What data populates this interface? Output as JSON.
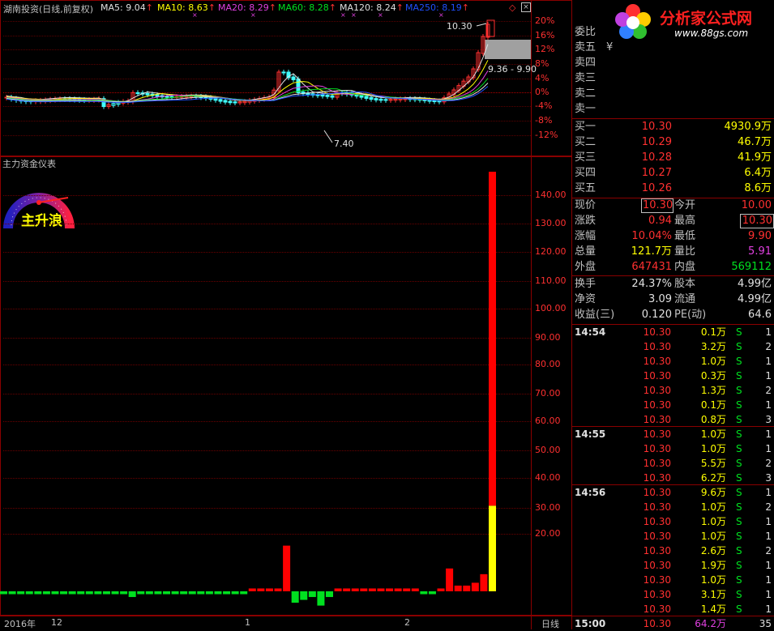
{
  "chart_title": "湖南投资(日线,前复权)",
  "ma_legend": [
    {
      "label": "MA5: 9.04",
      "color": "#e0e0e0"
    },
    {
      "label": "MA10: 8.63",
      "color": "#ffff00"
    },
    {
      "label": "MA20: 8.29",
      "color": "#e040e0"
    },
    {
      "label": "MA60: 8.28",
      "color": "#00e020"
    },
    {
      "label": "MA120: 8.24",
      "color": "#e0e0e0"
    },
    {
      "label": "MA250: 8.19",
      "color": "#2050ff"
    }
  ],
  "price_axis": [
    "20%",
    "16%",
    "12%",
    "8%",
    "4%",
    "0%",
    "-4%",
    "-8%",
    "-12%"
  ],
  "annotations": {
    "high": "10.30",
    "low": "7.40",
    "range": "9.36 - 9.90"
  },
  "indicator_title": "主力资金仪表",
  "gauge_label": "主升浪",
  "indicator_axis": [
    "140.00",
    "130.00",
    "120.00",
    "110.00",
    "100.00",
    "90.00",
    "80.00",
    "70.00",
    "60.00",
    "50.00",
    "40.00",
    "30.00",
    "20.00"
  ],
  "date_axis": {
    "year": "2016年",
    "m12": "12",
    "m1": "1",
    "m2": "2"
  },
  "period_label": "日线",
  "logo": {
    "text": "分析家公式网",
    "url": "www.88gs.com"
  },
  "colors": {
    "up": "#ff3030",
    "down": "#00e020",
    "frame": "#8a0000",
    "cyan": "#40ffff",
    "yellow": "#ffff00"
  },
  "chart_data": {
    "type": "bar",
    "title": "主力资金仪表",
    "ylim": [
      0,
      150
    ],
    "series": [
      {
        "values": [
          -1,
          -1,
          -1,
          -1,
          -1,
          -1,
          -1,
          -1,
          -1,
          -1,
          -1,
          -1,
          -1,
          -1,
          -1,
          -2,
          -1,
          -1,
          -1,
          -1,
          -1,
          -1,
          -1,
          -1,
          -1,
          -1,
          -1,
          -1,
          -1,
          1,
          1,
          1,
          1,
          16,
          -4,
          -3,
          -2,
          -5,
          -2,
          1,
          1,
          1,
          1,
          1,
          1,
          1,
          1,
          1,
          1,
          -1,
          -1,
          1,
          8,
          2,
          2,
          3,
          6,
          147
        ]
      }
    ]
  },
  "order_book": {
    "wei_bi": "委比",
    "sell": [
      {
        "label": "卖五",
        "price": "¥",
        "vol": ""
      },
      {
        "label": "卖四",
        "price": "",
        "vol": ""
      },
      {
        "label": "卖三",
        "price": "",
        "vol": ""
      },
      {
        "label": "卖二",
        "price": "",
        "vol": ""
      },
      {
        "label": "卖一",
        "price": "",
        "vol": ""
      }
    ],
    "buy": [
      {
        "label": "买一",
        "price": "10.30",
        "vol": "4930.9万"
      },
      {
        "label": "买二",
        "price": "10.29",
        "vol": "46.7万"
      },
      {
        "label": "买三",
        "price": "10.28",
        "vol": "41.9万"
      },
      {
        "label": "买四",
        "price": "10.27",
        "vol": "6.4万"
      },
      {
        "label": "买五",
        "price": "10.26",
        "vol": "8.6万"
      }
    ]
  },
  "quote": {
    "xianjia_l": "现价",
    "xianjia": "10.30",
    "jinkai_l": "今开",
    "jinkai": "10.00",
    "zhangdie_l": "涨跌",
    "zhangdie": "0.94",
    "zuigao_l": "最高",
    "zuigao": "10.30",
    "zhangfu_l": "涨幅",
    "zhangfu": "10.04%",
    "zuidi_l": "最低",
    "zuidi": "9.90",
    "zongliang_l": "总量",
    "zongliang": "121.7万",
    "liangbi_l": "量比",
    "liangbi": "5.91",
    "waipan_l": "外盘",
    "waipan": "647431",
    "neipan_l": "内盘",
    "neipan": "569112"
  },
  "fund": {
    "huanshou_l": "换手",
    "huanshou": "24.37%",
    "guben_l": "股本",
    "guben": "4.99亿",
    "jingzi_l": "净资",
    "jingzi": "3.09",
    "liutong_l": "流通",
    "liutong": "4.99亿",
    "shouyi_l": "收益(三)",
    "shouyi": "0.120",
    "pe_l": "PE(动)",
    "pe": "64.6"
  },
  "ticks": [
    {
      "time": "14:54",
      "price": "10.30",
      "vol": "0.1万",
      "bs": "S",
      "n": "1"
    },
    {
      "time": "",
      "price": "10.30",
      "vol": "3.2万",
      "bs": "S",
      "n": "2"
    },
    {
      "time": "",
      "price": "10.30",
      "vol": "1.0万",
      "bs": "S",
      "n": "1"
    },
    {
      "time": "",
      "price": "10.30",
      "vol": "0.3万",
      "bs": "S",
      "n": "1"
    },
    {
      "time": "",
      "price": "10.30",
      "vol": "1.3万",
      "bs": "S",
      "n": "2"
    },
    {
      "time": "",
      "price": "10.30",
      "vol": "0.1万",
      "bs": "S",
      "n": "1"
    },
    {
      "time": "",
      "price": "10.30",
      "vol": "0.8万",
      "bs": "S",
      "n": "3"
    },
    {
      "time": "14:55",
      "price": "10.30",
      "vol": "1.0万",
      "bs": "S",
      "n": "1"
    },
    {
      "time": "",
      "price": "10.30",
      "vol": "1.0万",
      "bs": "S",
      "n": "1"
    },
    {
      "time": "",
      "price": "10.30",
      "vol": "5.5万",
      "bs": "S",
      "n": "2"
    },
    {
      "time": "",
      "price": "10.30",
      "vol": "6.2万",
      "bs": "S",
      "n": "3"
    },
    {
      "time": "14:56",
      "price": "10.30",
      "vol": "9.6万",
      "bs": "S",
      "n": "1"
    },
    {
      "time": "",
      "price": "10.30",
      "vol": "1.0万",
      "bs": "S",
      "n": "2"
    },
    {
      "time": "",
      "price": "10.30",
      "vol": "1.0万",
      "bs": "S",
      "n": "1"
    },
    {
      "time": "",
      "price": "10.30",
      "vol": "1.0万",
      "bs": "S",
      "n": "1"
    },
    {
      "time": "",
      "price": "10.30",
      "vol": "2.6万",
      "bs": "S",
      "n": "2"
    },
    {
      "time": "",
      "price": "10.30",
      "vol": "1.9万",
      "bs": "S",
      "n": "1"
    },
    {
      "time": "",
      "price": "10.30",
      "vol": "1.0万",
      "bs": "S",
      "n": "1"
    },
    {
      "time": "",
      "price": "10.30",
      "vol": "3.1万",
      "bs": "S",
      "n": "1"
    },
    {
      "time": "",
      "price": "10.30",
      "vol": "1.4万",
      "bs": "S",
      "n": "1"
    },
    {
      "time": "15:00",
      "price": "10.30",
      "vol": "64.2万",
      "bs": "",
      "n": "35"
    }
  ]
}
